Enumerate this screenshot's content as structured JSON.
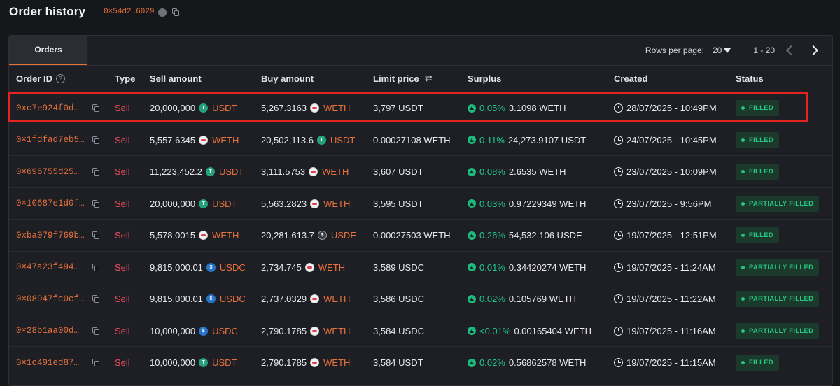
{
  "header": {
    "title": "Order history",
    "address": "0×54d2…6029"
  },
  "tabs": [
    {
      "label": "Orders",
      "active": true
    }
  ],
  "pagination": {
    "rows_per_page_label": "Rows per page:",
    "rows_per_page": "20",
    "range": "1 - 20"
  },
  "columns": {
    "order_id": "Order ID",
    "type": "Type",
    "sell_amount": "Sell amount",
    "buy_amount": "Buy amount",
    "limit_price": "Limit price",
    "surplus": "Surplus",
    "created": "Created",
    "status": "Status"
  },
  "colors": {
    "accent": "#e8713c",
    "sell": "#ef4b5c",
    "positive": "#1fc888",
    "highlight": "#e52222"
  },
  "orders": [
    {
      "id": "0xc7e924f0d…",
      "type": "Sell",
      "sell_amount": "20,000,000",
      "sell_token": "USDT",
      "buy_amount": "5,267.3163",
      "buy_token": "WETH",
      "limit_price": "3,797 USDT",
      "surplus_pct": "0.05%",
      "surplus_amount": "3.1098 WETH",
      "created": "28/07/2025 - 10:49PM",
      "status": "FILLED",
      "highlighted": true
    },
    {
      "id": "0×1fdfad7eb5…",
      "type": "Sell",
      "sell_amount": "5,557.6345",
      "sell_token": "WETH",
      "buy_amount": "20,502,113.6",
      "buy_token": "USDT",
      "limit_price": "0.00027108 WETH",
      "surplus_pct": "0.11%",
      "surplus_amount": "24,273.9107 USDT",
      "created": "24/07/2025 - 10:45PM",
      "status": "FILLED"
    },
    {
      "id": "0×696755d25…",
      "type": "Sell",
      "sell_amount": "11,223,452.2",
      "sell_token": "USDT",
      "buy_amount": "3,111.5753",
      "buy_token": "WETH",
      "limit_price": "3,607 USDT",
      "surplus_pct": "0.08%",
      "surplus_amount": "2.6535 WETH",
      "created": "23/07/2025 - 10:09PM",
      "status": "FILLED"
    },
    {
      "id": "0×10687e1d0f…",
      "type": "Sell",
      "sell_amount": "20,000,000",
      "sell_token": "USDT",
      "buy_amount": "5,563.2823",
      "buy_token": "WETH",
      "limit_price": "3,595 USDT",
      "surplus_pct": "0.03%",
      "surplus_amount": "0.97229349 WETH",
      "created": "23/07/2025 - 9:56PM",
      "status": "PARTIALLY FILLED"
    },
    {
      "id": "0xba079f769b…",
      "type": "Sell",
      "sell_amount": "5,578.0015",
      "sell_token": "WETH",
      "buy_amount": "20,281,613.7",
      "buy_token": "USDE",
      "limit_price": "0.00027503 WETH",
      "surplus_pct": "0.26%",
      "surplus_amount": "54,532.106 USDE",
      "created": "19/07/2025 - 12:51PM",
      "status": "FILLED"
    },
    {
      "id": "0×47a23f494…",
      "type": "Sell",
      "sell_amount": "9,815,000.01",
      "sell_token": "USDC",
      "buy_amount": "2,734.745",
      "buy_token": "WETH",
      "limit_price": "3,589 USDC",
      "surplus_pct": "0.01%",
      "surplus_amount": "0.34420274 WETH",
      "created": "19/07/2025 - 11:24AM",
      "status": "PARTIALLY FILLED"
    },
    {
      "id": "0×08947fc0cf…",
      "type": "Sell",
      "sell_amount": "9,815,000.01",
      "sell_token": "USDC",
      "buy_amount": "2,737.0329",
      "buy_token": "WETH",
      "limit_price": "3,586 USDC",
      "surplus_pct": "0.02%",
      "surplus_amount": "0.105769 WETH",
      "created": "19/07/2025 - 11:22AM",
      "status": "PARTIALLY FILLED"
    },
    {
      "id": "0×28b1aa00d…",
      "type": "Sell",
      "sell_amount": "10,000,000",
      "sell_token": "USDC",
      "buy_amount": "2,790.1785",
      "buy_token": "WETH",
      "limit_price": "3,584 USDC",
      "surplus_pct": "<0.01%",
      "surplus_amount": "0.00165404 WETH",
      "created": "19/07/2025 - 11:16AM",
      "status": "PARTIALLY FILLED"
    },
    {
      "id": "0×1c491ed87…",
      "type": "Sell",
      "sell_amount": "10,000,000",
      "sell_token": "USDT",
      "buy_amount": "2,790.1785",
      "buy_token": "WETH",
      "limit_price": "3,584 USDT",
      "surplus_pct": "0.02%",
      "surplus_amount": "0.56862578 WETH",
      "created": "19/07/2025 - 11:15AM",
      "status": "FILLED"
    }
  ]
}
